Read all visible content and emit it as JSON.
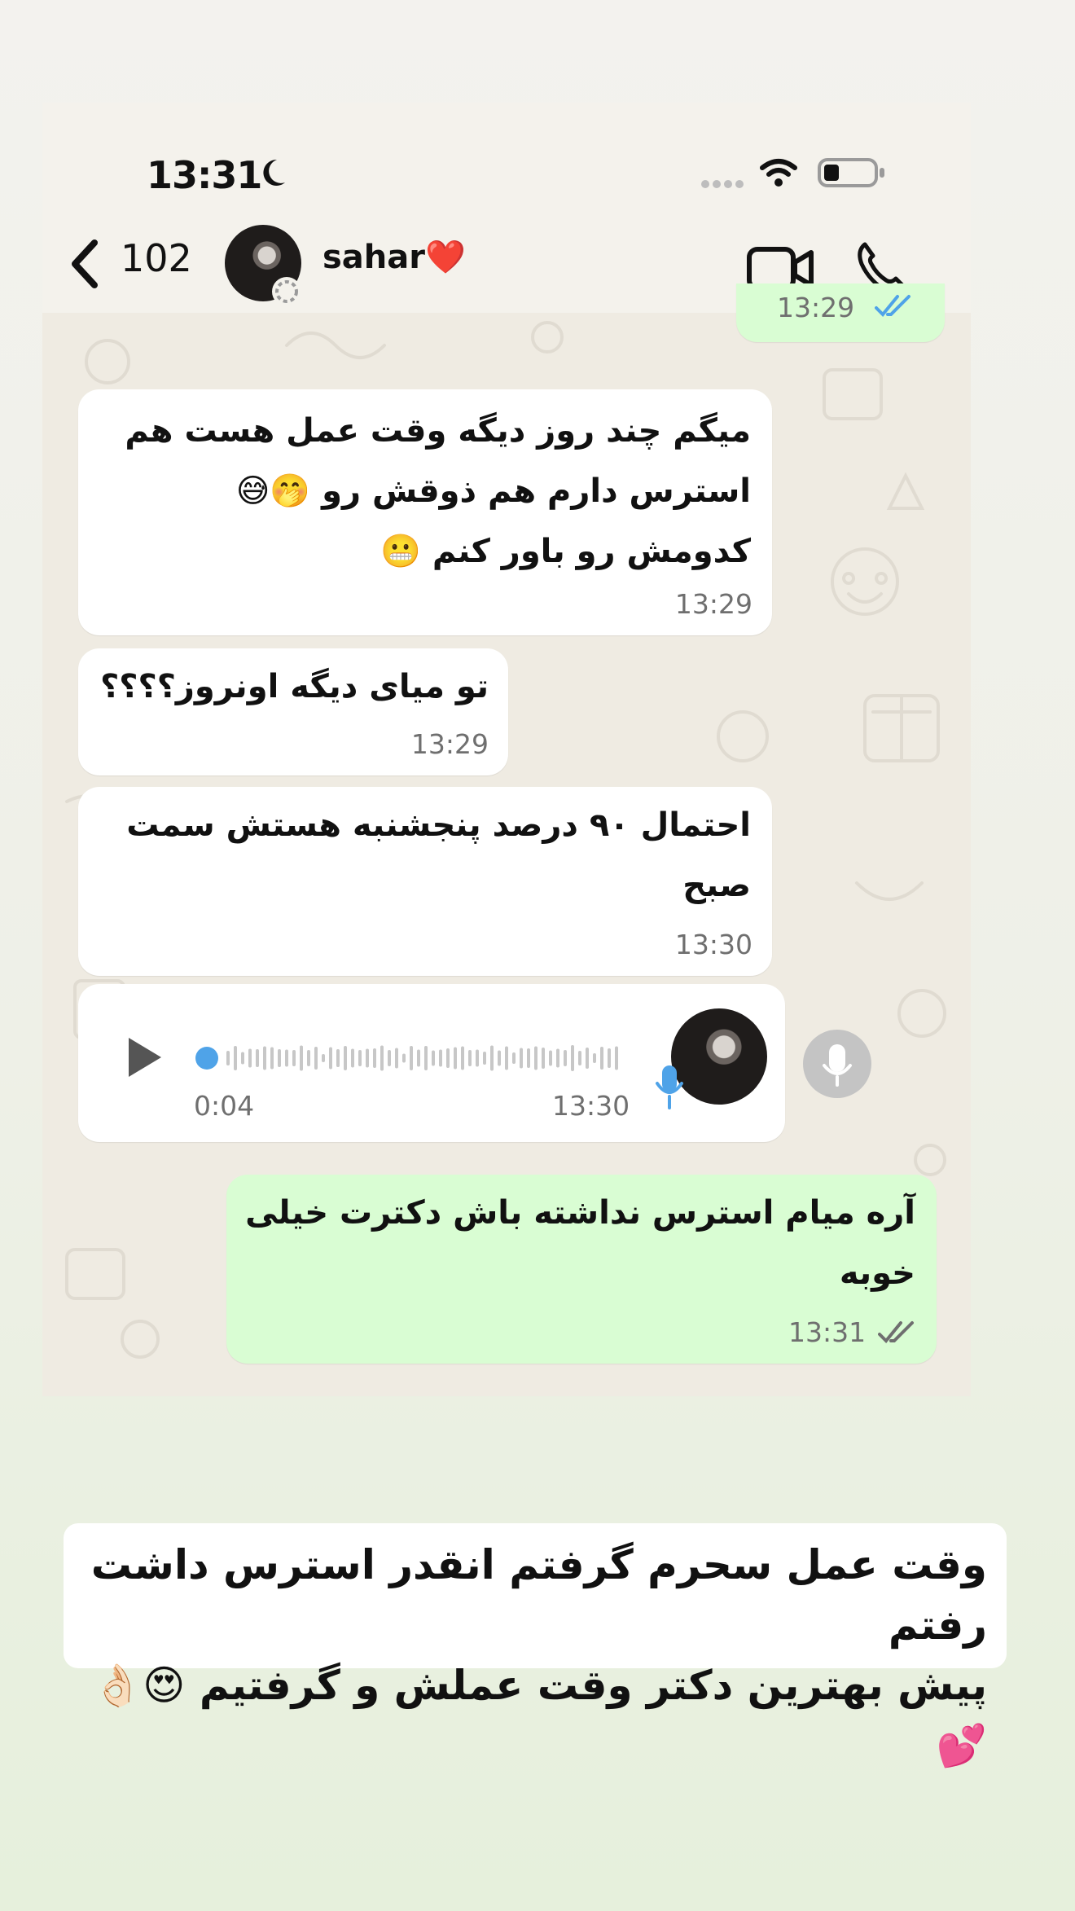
{
  "status_bar": {
    "time": "13:31"
  },
  "header": {
    "back_count": "102",
    "contact_name": "sahar❤️"
  },
  "messages": [
    {
      "text": "13:29",
      "kind": "timestamp-only"
    },
    {
      "text": "میگم چند روز دیگه وقت عمل هست هم\nاسترس دارم هم ذوقش رو 🤭😅\nکدومش رو باور کنم 😬",
      "time": "13:29"
    },
    {
      "text": "تو میای دیگه اونروز؟؟؟؟",
      "time": "13:29"
    },
    {
      "text": "احتمال ۹۰ درصد پنجشنبه هستش سمت\nصبح",
      "time": "13:30"
    },
    {
      "duration": "0:04",
      "time": "13:30"
    },
    {
      "text": "آره میام استرس نداشته باش دکترت خیلی\nخوبه",
      "time": "13:31"
    }
  ],
  "caption": "وقت عمل سحرم گرفتم انقدر استرس داشت رفتم\nپیش بهترین دکتر وقت عملش و گرفتیم 😍👌🏻💕",
  "colors": {
    "incoming_bubble": "#ffffff",
    "outgoing_bubble": "#d9fdd3",
    "read_ticks": "#4fa3e8",
    "wallpaper": "#efebe2"
  }
}
